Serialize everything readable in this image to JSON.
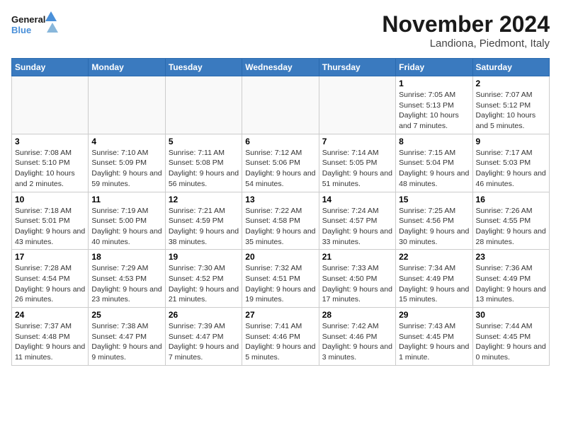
{
  "header": {
    "logo_line1": "General",
    "logo_line2": "Blue",
    "month": "November 2024",
    "location": "Landiona, Piedmont, Italy"
  },
  "weekdays": [
    "Sunday",
    "Monday",
    "Tuesday",
    "Wednesday",
    "Thursday",
    "Friday",
    "Saturday"
  ],
  "weeks": [
    [
      {
        "day": "",
        "info": ""
      },
      {
        "day": "",
        "info": ""
      },
      {
        "day": "",
        "info": ""
      },
      {
        "day": "",
        "info": ""
      },
      {
        "day": "",
        "info": ""
      },
      {
        "day": "1",
        "info": "Sunrise: 7:05 AM\nSunset: 5:13 PM\nDaylight: 10 hours and 7 minutes."
      },
      {
        "day": "2",
        "info": "Sunrise: 7:07 AM\nSunset: 5:12 PM\nDaylight: 10 hours and 5 minutes."
      }
    ],
    [
      {
        "day": "3",
        "info": "Sunrise: 7:08 AM\nSunset: 5:10 PM\nDaylight: 10 hours and 2 minutes."
      },
      {
        "day": "4",
        "info": "Sunrise: 7:10 AM\nSunset: 5:09 PM\nDaylight: 9 hours and 59 minutes."
      },
      {
        "day": "5",
        "info": "Sunrise: 7:11 AM\nSunset: 5:08 PM\nDaylight: 9 hours and 56 minutes."
      },
      {
        "day": "6",
        "info": "Sunrise: 7:12 AM\nSunset: 5:06 PM\nDaylight: 9 hours and 54 minutes."
      },
      {
        "day": "7",
        "info": "Sunrise: 7:14 AM\nSunset: 5:05 PM\nDaylight: 9 hours and 51 minutes."
      },
      {
        "day": "8",
        "info": "Sunrise: 7:15 AM\nSunset: 5:04 PM\nDaylight: 9 hours and 48 minutes."
      },
      {
        "day": "9",
        "info": "Sunrise: 7:17 AM\nSunset: 5:03 PM\nDaylight: 9 hours and 46 minutes."
      }
    ],
    [
      {
        "day": "10",
        "info": "Sunrise: 7:18 AM\nSunset: 5:01 PM\nDaylight: 9 hours and 43 minutes."
      },
      {
        "day": "11",
        "info": "Sunrise: 7:19 AM\nSunset: 5:00 PM\nDaylight: 9 hours and 40 minutes."
      },
      {
        "day": "12",
        "info": "Sunrise: 7:21 AM\nSunset: 4:59 PM\nDaylight: 9 hours and 38 minutes."
      },
      {
        "day": "13",
        "info": "Sunrise: 7:22 AM\nSunset: 4:58 PM\nDaylight: 9 hours and 35 minutes."
      },
      {
        "day": "14",
        "info": "Sunrise: 7:24 AM\nSunset: 4:57 PM\nDaylight: 9 hours and 33 minutes."
      },
      {
        "day": "15",
        "info": "Sunrise: 7:25 AM\nSunset: 4:56 PM\nDaylight: 9 hours and 30 minutes."
      },
      {
        "day": "16",
        "info": "Sunrise: 7:26 AM\nSunset: 4:55 PM\nDaylight: 9 hours and 28 minutes."
      }
    ],
    [
      {
        "day": "17",
        "info": "Sunrise: 7:28 AM\nSunset: 4:54 PM\nDaylight: 9 hours and 26 minutes."
      },
      {
        "day": "18",
        "info": "Sunrise: 7:29 AM\nSunset: 4:53 PM\nDaylight: 9 hours and 23 minutes."
      },
      {
        "day": "19",
        "info": "Sunrise: 7:30 AM\nSunset: 4:52 PM\nDaylight: 9 hours and 21 minutes."
      },
      {
        "day": "20",
        "info": "Sunrise: 7:32 AM\nSunset: 4:51 PM\nDaylight: 9 hours and 19 minutes."
      },
      {
        "day": "21",
        "info": "Sunrise: 7:33 AM\nSunset: 4:50 PM\nDaylight: 9 hours and 17 minutes."
      },
      {
        "day": "22",
        "info": "Sunrise: 7:34 AM\nSunset: 4:49 PM\nDaylight: 9 hours and 15 minutes."
      },
      {
        "day": "23",
        "info": "Sunrise: 7:36 AM\nSunset: 4:49 PM\nDaylight: 9 hours and 13 minutes."
      }
    ],
    [
      {
        "day": "24",
        "info": "Sunrise: 7:37 AM\nSunset: 4:48 PM\nDaylight: 9 hours and 11 minutes."
      },
      {
        "day": "25",
        "info": "Sunrise: 7:38 AM\nSunset: 4:47 PM\nDaylight: 9 hours and 9 minutes."
      },
      {
        "day": "26",
        "info": "Sunrise: 7:39 AM\nSunset: 4:47 PM\nDaylight: 9 hours and 7 minutes."
      },
      {
        "day": "27",
        "info": "Sunrise: 7:41 AM\nSunset: 4:46 PM\nDaylight: 9 hours and 5 minutes."
      },
      {
        "day": "28",
        "info": "Sunrise: 7:42 AM\nSunset: 4:46 PM\nDaylight: 9 hours and 3 minutes."
      },
      {
        "day": "29",
        "info": "Sunrise: 7:43 AM\nSunset: 4:45 PM\nDaylight: 9 hours and 1 minute."
      },
      {
        "day": "30",
        "info": "Sunrise: 7:44 AM\nSunset: 4:45 PM\nDaylight: 9 hours and 0 minutes."
      }
    ]
  ]
}
